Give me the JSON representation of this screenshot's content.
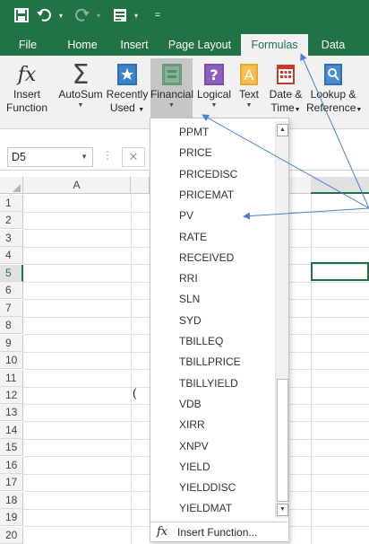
{
  "quick_access": {
    "save_icon": "save-icon",
    "undo_icon": "undo-icon",
    "redo_icon": "redo-icon",
    "form_icon": "form-icon",
    "customize_glyph": "="
  },
  "tabs": [
    "File",
    "Home",
    "Insert",
    "Page Layout",
    "Formulas",
    "Data"
  ],
  "active_tab": "Formulas",
  "ribbon": {
    "insert_function": [
      "Insert",
      "Function"
    ],
    "autosum": "AutoSum",
    "recently_used": [
      "Recently",
      "Used"
    ],
    "financial": "Financial",
    "logical": "Logical",
    "text": "Text",
    "date_time": [
      "Date &",
      "Time"
    ],
    "lookup_reference": [
      "Lookup &",
      "Reference"
    ]
  },
  "name_box": {
    "value": "D5"
  },
  "formula_bar": {
    "cancel_glyph": "✕",
    "separator": "⋮"
  },
  "grid": {
    "column_headers": [
      "A"
    ],
    "row_headers": [
      "1",
      "2",
      "3",
      "4",
      "5",
      "6",
      "7",
      "8",
      "9",
      "10",
      "11",
      "12",
      "13",
      "14",
      "15",
      "16",
      "17",
      "18",
      "19",
      "20"
    ],
    "active_row": "5",
    "cell_paren": "("
  },
  "financial_menu": {
    "items": [
      "PPMT",
      "PRICE",
      "PRICEDISC",
      "PRICEMAT",
      "PV",
      "RATE",
      "RECEIVED",
      "RRI",
      "SLN",
      "SYD",
      "TBILLEQ",
      "TBILLPRICE",
      "TBILLYIELD",
      "VDB",
      "XIRR",
      "XNPV",
      "YIELD",
      "YIELDDISC",
      "YIELDMAT"
    ],
    "insert_function_label": "Insert Function...",
    "insert_function_glyph": "fx"
  },
  "colors": {
    "excel_green": "#217346",
    "arrow_blue": "#4a7fd4",
    "ribbon_gray": "#f1f1f1"
  }
}
